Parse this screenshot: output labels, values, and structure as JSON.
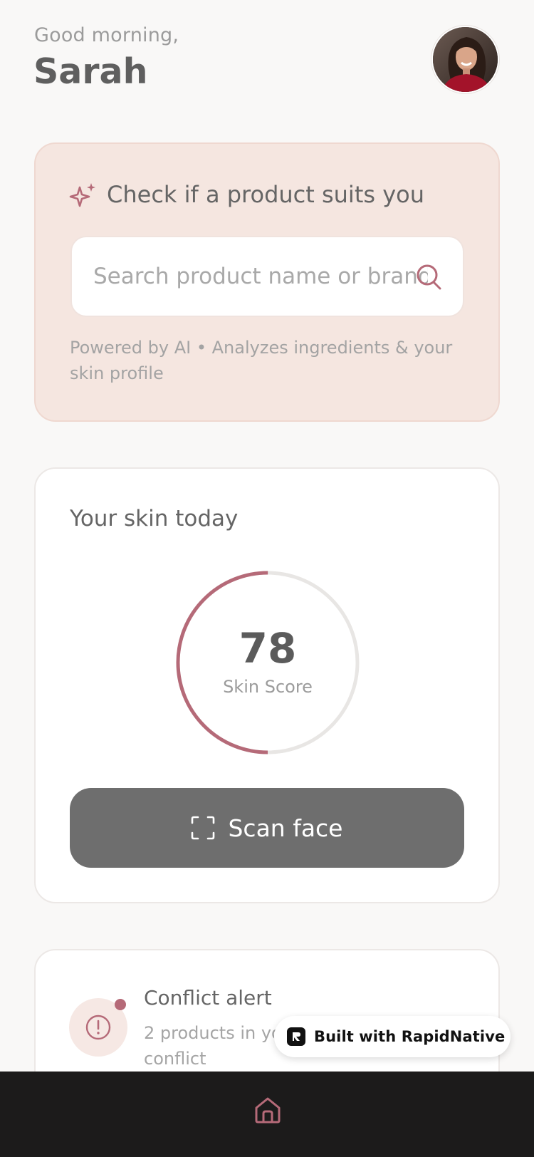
{
  "header": {
    "greeting": "Good morning,",
    "user_name": "Sarah",
    "avatar_alt": "Profile photo"
  },
  "product_check": {
    "title": "Check if a product suits you",
    "title_icon": "sparkle-icon",
    "search_placeholder": "Search product name or brand",
    "search_value": "",
    "search_icon": "search-icon",
    "note": "Powered by AI • Analyzes ingredients & your skin profile"
  },
  "skin": {
    "title": "Your skin today",
    "score": 78,
    "score_display": "78",
    "score_label": "Skin Score",
    "score_fraction": 0.5,
    "scan_button_label": "Scan face",
    "scan_icon": "scan-frame-icon"
  },
  "conflict": {
    "title": "Conflict alert",
    "description": "2 products in your routine may conflict",
    "icon": "alert-circle-icon"
  },
  "badge": {
    "label": "Built with RapidNative"
  },
  "nav": {
    "home_icon": "home-icon"
  },
  "colors": {
    "accent": "#b56a78",
    "card_tint": "#f5e6e0",
    "button": "#6e6e6e",
    "nav_bg": "#1c1b1b",
    "background": "#f9f8f7"
  }
}
